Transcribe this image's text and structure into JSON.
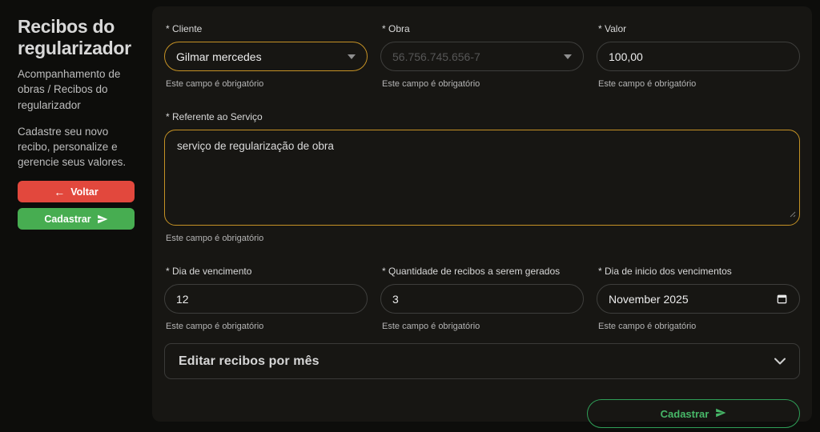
{
  "sidebar": {
    "title": "Recibos do regularizador",
    "breadcrumb": "Acompanhamento de obras / Recibos do regularizador",
    "description": "Cadastre seu novo recibo, personalize e gerencie seus valores.",
    "back_button": {
      "icon": "←",
      "label": "Voltar"
    },
    "submit_button": {
      "label": "Cadastrar",
      "icon": "send-plane"
    }
  },
  "form": {
    "fields": {
      "cliente": {
        "label": "* Cliente",
        "value": "Gilmar mercedes",
        "helper": "Este campo é obrigatório"
      },
      "obra": {
        "label": "* Obra",
        "value": "56.756.745.656-7",
        "helper": "Este campo é obrigatório"
      },
      "valor": {
        "label": "* Valor",
        "value": "100,00",
        "helper": "Este campo é obrigatório"
      },
      "referente": {
        "label": "* Referente ao Serviço",
        "value": "serviço de regularização de obra",
        "helper": "Este campo é obrigatório"
      },
      "dia_vencimento": {
        "label": "* Dia de vencimento",
        "value": "12",
        "helper": "Este campo é obrigatório"
      },
      "quantidade": {
        "label": "* Quantidade de recibos a serem gerados",
        "value": "3",
        "helper": "Este campo é obrigatório"
      },
      "dia_inicio": {
        "label": "* Dia de inicio dos vencimentos",
        "value": "November 2025",
        "helper": "Este campo é obrigatório"
      }
    },
    "accordion": {
      "label": "Editar recibos por mês"
    },
    "submit_button": {
      "label": "Cadastrar",
      "icon": "send-plane"
    }
  },
  "colors": {
    "page_bg": "#0d0d0b",
    "panel_bg": "#171613",
    "accent_gold": "#c59225",
    "button_red": "#e2483d",
    "button_green": "#47ad51",
    "outline_green": "#2f9e57",
    "green_text": "#47b768"
  }
}
